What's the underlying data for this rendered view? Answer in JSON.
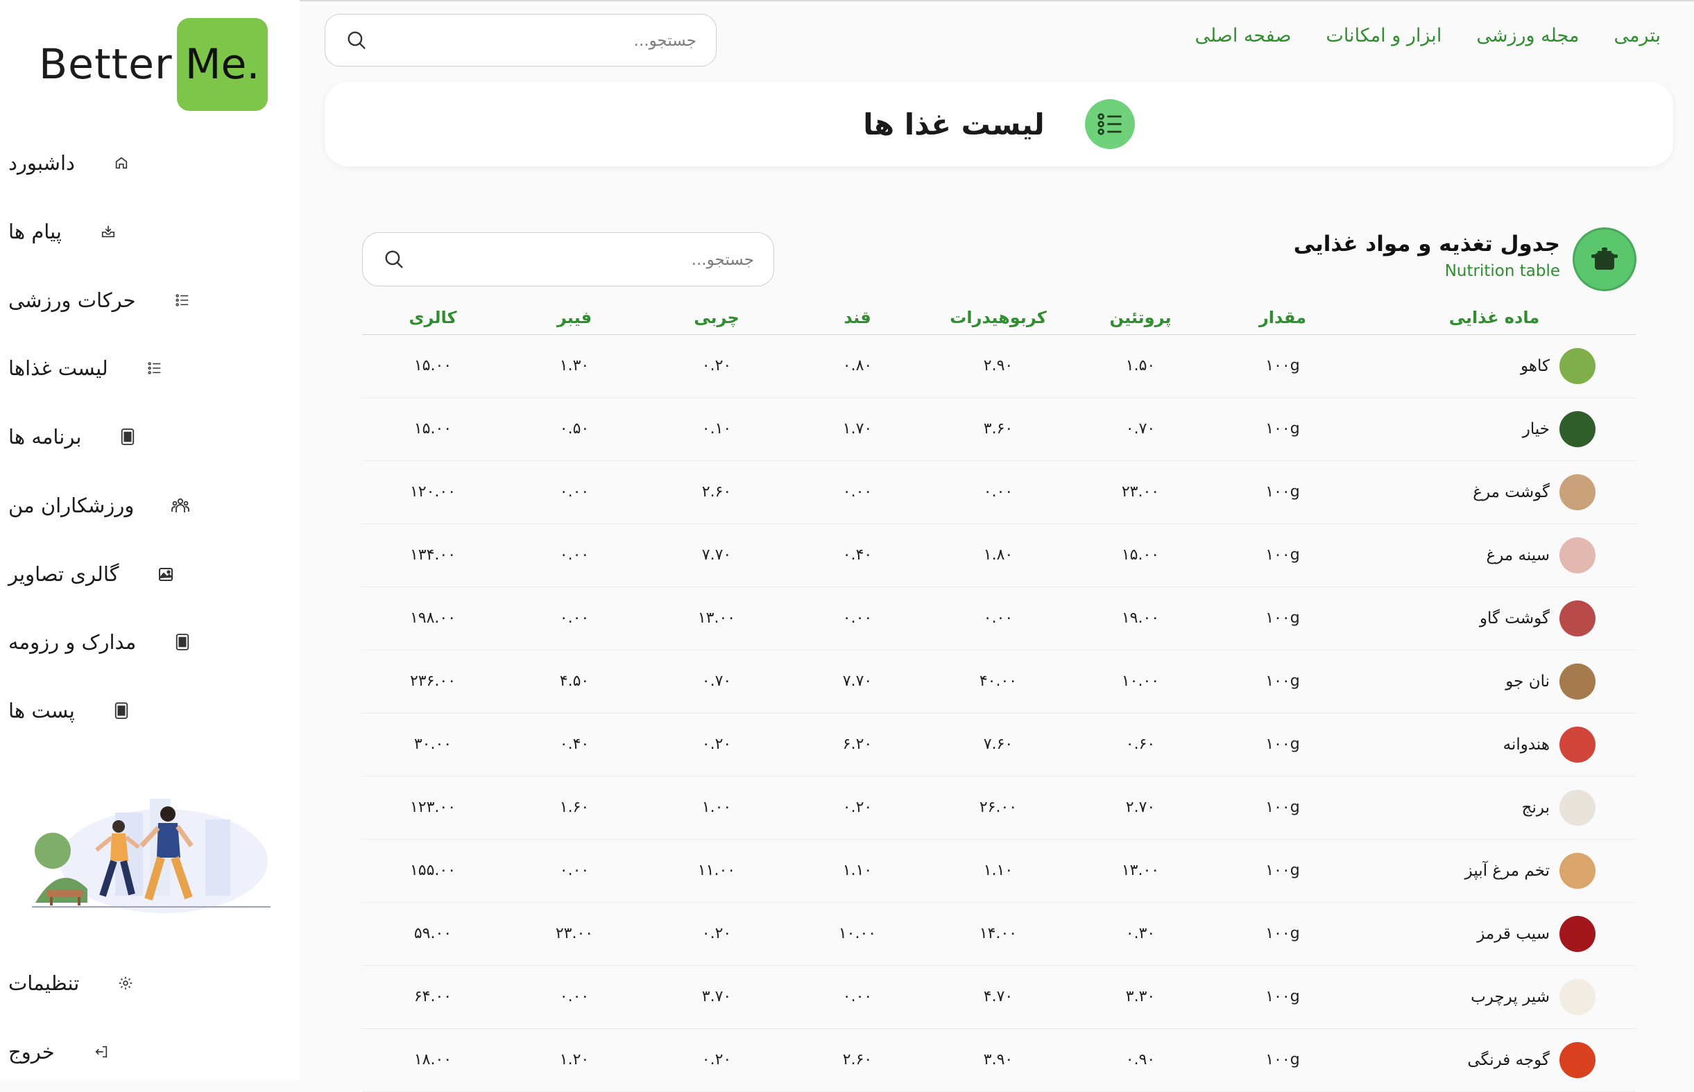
{
  "logo": {
    "part1": "Better",
    "part2": "Me."
  },
  "sidebar": {
    "items": [
      {
        "label": "داشبورد",
        "icon": "home-icon"
      },
      {
        "label": "پیام ها",
        "icon": "inbox-icon"
      },
      {
        "label": "حرکات ورزشی",
        "icon": "list-icon"
      },
      {
        "label": "لیست غذاها",
        "icon": "list-icon"
      },
      {
        "label": "برنامه ها",
        "icon": "document-icon"
      },
      {
        "label": "ورزشکاران من",
        "icon": "users-icon"
      },
      {
        "label": "گالری تصاویر",
        "icon": "gallery-icon"
      },
      {
        "label": "مدارک و رزومه",
        "icon": "document-icon"
      },
      {
        "label": "پست ها",
        "icon": "document-icon"
      }
    ],
    "settings": "تنظیمات",
    "logout": "خروج"
  },
  "topnav": [
    "صفحه اصلی",
    "ابزار و امکانات",
    "مجله ورزشی",
    "بترمی"
  ],
  "search": {
    "placeholder": "جستجو..."
  },
  "page_title": "لیست غذا ها",
  "table": {
    "title": "جدول تغذیه و مواد غذایی",
    "subtitle": "Nutrition table",
    "search_placeholder": "جستجو...",
    "columns": [
      "ماده غذایی",
      "مقدار",
      "پروتئین",
      "کربوهیدرات",
      "قند",
      "چربی",
      "فیبر",
      "کالری"
    ],
    "rows": [
      {
        "name": "کاهو",
        "color": "#7fae4a",
        "amount": "۱۰۰g",
        "protein": "۱.۵۰",
        "carbs": "۲.۹۰",
        "sugar": "۰.۸۰",
        "fat": "۰.۲۰",
        "fiber": "۱.۳۰",
        "cal": "۱۵.۰۰"
      },
      {
        "name": "خیار",
        "color": "#2f5e2a",
        "amount": "۱۰۰g",
        "protein": "۰.۷۰",
        "carbs": "۳.۶۰",
        "sugar": "۱.۷۰",
        "fat": "۰.۱۰",
        "fiber": "۰.۵۰",
        "cal": "۱۵.۰۰"
      },
      {
        "name": "گوشت مرغ",
        "color": "#c9a27a",
        "amount": "۱۰۰g",
        "protein": "۲۳.۰۰",
        "carbs": "۰.۰۰",
        "sugar": "۰.۰۰",
        "fat": "۲.۶۰",
        "fiber": "۰.۰۰",
        "cal": "۱۲۰.۰۰"
      },
      {
        "name": "سینه مرغ",
        "color": "#e3b8b0",
        "amount": "۱۰۰g",
        "protein": "۱۵.۰۰",
        "carbs": "۱.۸۰",
        "sugar": "۰.۴۰",
        "fat": "۷.۷۰",
        "fiber": "۰.۰۰",
        "cal": "۱۳۴.۰۰"
      },
      {
        "name": "گوشت گاو",
        "color": "#b84a4a",
        "amount": "۱۰۰g",
        "protein": "۱۹.۰۰",
        "carbs": "۰.۰۰",
        "sugar": "۰.۰۰",
        "fat": "۱۳.۰۰",
        "fiber": "۰.۰۰",
        "cal": "۱۹۸.۰۰"
      },
      {
        "name": "نان جو",
        "color": "#a57a4c",
        "amount": "۱۰۰g",
        "protein": "۱۰.۰۰",
        "carbs": "۴۰.۰۰",
        "sugar": "۷.۷۰",
        "fat": "۰.۷۰",
        "fiber": "۴.۵۰",
        "cal": "۲۳۶.۰۰"
      },
      {
        "name": "هندوانه",
        "color": "#d2453a",
        "amount": "۱۰۰g",
        "protein": "۰.۶۰",
        "carbs": "۷.۶۰",
        "sugar": "۶.۲۰",
        "fat": "۰.۲۰",
        "fiber": "۰.۴۰",
        "cal": "۳۰.۰۰"
      },
      {
        "name": "برنج",
        "color": "#e8e4dc",
        "amount": "۱۰۰g",
        "protein": "۲.۷۰",
        "carbs": "۲۶.۰۰",
        "sugar": "۰.۲۰",
        "fat": "۱.۰۰",
        "fiber": "۱.۶۰",
        "cal": "۱۲۳.۰۰"
      },
      {
        "name": "تخم مرغ آبپز",
        "color": "#d9a56a",
        "amount": "۱۰۰g",
        "protein": "۱۳.۰۰",
        "carbs": "۱.۱۰",
        "sugar": "۱.۱۰",
        "fat": "۱۱.۰۰",
        "fiber": "۰.۰۰",
        "cal": "۱۵۵.۰۰"
      },
      {
        "name": "سیب قرمز",
        "color": "#a3161c",
        "amount": "۱۰۰g",
        "protein": "۰.۳۰",
        "carbs": "۱۴.۰۰",
        "sugar": "۱۰.۰۰",
        "fat": "۰.۲۰",
        "fiber": "۲۳.۰۰",
        "cal": "۵۹.۰۰"
      },
      {
        "name": "شیر پرچرب",
        "color": "#f1ede2",
        "amount": "۱۰۰g",
        "protein": "۳.۳۰",
        "carbs": "۴.۷۰",
        "sugar": "۰.۰۰",
        "fat": "۳.۷۰",
        "fiber": "۰.۰۰",
        "cal": "۶۴.۰۰"
      },
      {
        "name": "گوجه فرنگی",
        "color": "#d9401f",
        "amount": "۱۰۰g",
        "protein": "۰.۹۰",
        "carbs": "۳.۹۰",
        "sugar": "۲.۶۰",
        "fat": "۰.۲۰",
        "fiber": "۱.۲۰",
        "cal": "۱۸.۰۰"
      }
    ]
  },
  "colors": {
    "accent": "#7ec64a",
    "link": "#2f8f2f",
    "title_icon_bg": "#6fd27a"
  }
}
